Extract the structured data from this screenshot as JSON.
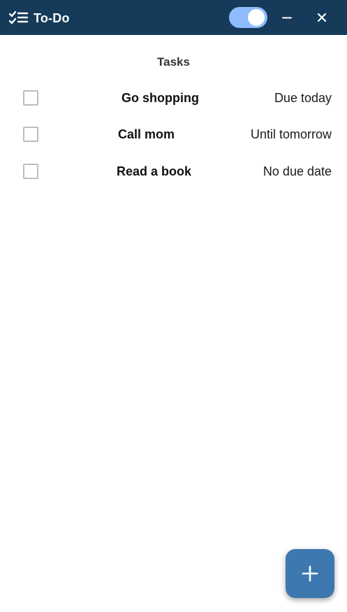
{
  "window": {
    "title": "To-Do",
    "app_icon": "checklist-icon",
    "toggle_on": true,
    "minimize_icon": "minimize-icon",
    "close_icon": "close-icon"
  },
  "main": {
    "section_title": "Tasks",
    "tasks": [
      {
        "name": "Go shopping",
        "due": "Due today",
        "completed": false
      },
      {
        "name": "Call mom",
        "due": "Until tomorrow",
        "completed": false
      },
      {
        "name": "Read a book",
        "due": "No due date",
        "completed": false
      }
    ]
  },
  "fab": {
    "icon": "plus-icon"
  },
  "colors": {
    "titlebar": "#163a59",
    "toggle_on": "#8fbcff",
    "fab": "#3e78b0"
  }
}
